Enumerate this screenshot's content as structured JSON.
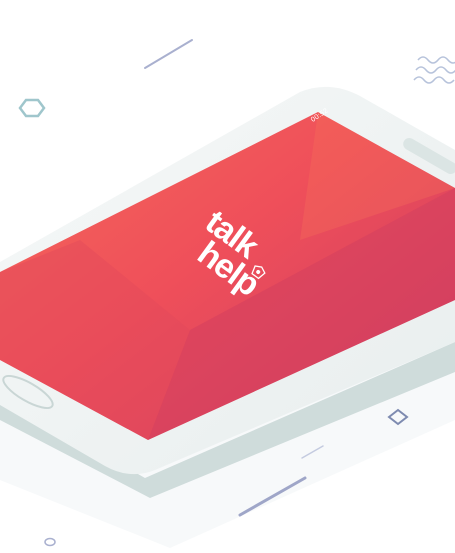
{
  "status_bar": {
    "time": "00:52"
  },
  "app": {
    "logo_line1": "talk",
    "logo_line2": "help"
  },
  "colors": {
    "screen_primary": "#f04e5a",
    "screen_secondary": "#c93a63",
    "device_body": "#eef2f2",
    "device_shadow": "#d8e2e1",
    "decor_line": "#9fa6c8",
    "decor_teal": "#b7d3d3"
  },
  "icons": [
    "hexagon-icon",
    "wave-icon",
    "diamond-icon",
    "shield-icon"
  ]
}
